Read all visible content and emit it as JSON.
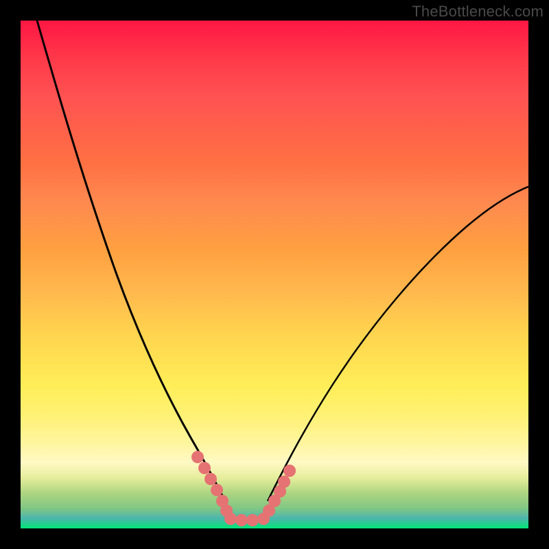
{
  "watermark": "TheBottleneck.com",
  "chart_data": {
    "type": "line",
    "title": "",
    "xlabel": "",
    "ylabel": "",
    "xlim": [
      0,
      100
    ],
    "ylim": [
      0,
      100
    ],
    "description": "Bottleneck V-curve on red-to-green vertical gradient (red=high bottleneck at top, green=optimal at bottom). Minimum region centered around x≈40–48.",
    "series": [
      {
        "name": "left-branch",
        "x": [
          3,
          6,
          10,
          15,
          20,
          25,
          30,
          34,
          37,
          40
        ],
        "values": [
          100,
          90,
          78,
          64,
          50,
          37,
          24,
          14,
          8,
          3
        ]
      },
      {
        "name": "right-branch",
        "x": [
          48,
          52,
          58,
          65,
          72,
          80,
          88,
          95,
          100
        ],
        "values": [
          3,
          8,
          16,
          26,
          36,
          46,
          55,
          62,
          67
        ]
      },
      {
        "name": "valley-floor",
        "x": [
          40,
          42,
          44,
          46,
          48
        ],
        "values": [
          1,
          0,
          0,
          0,
          1
        ]
      }
    ],
    "highlight_segments": {
      "description": "Salmon-colored thick dotted segments near the valley floor",
      "left": {
        "x": [
          34,
          40
        ],
        "values": [
          12,
          2
        ]
      },
      "right": {
        "x": [
          48,
          52
        ],
        "values": [
          2,
          10
        ]
      },
      "floor": {
        "x": [
          40,
          48
        ],
        "values": [
          1,
          1
        ]
      }
    }
  }
}
